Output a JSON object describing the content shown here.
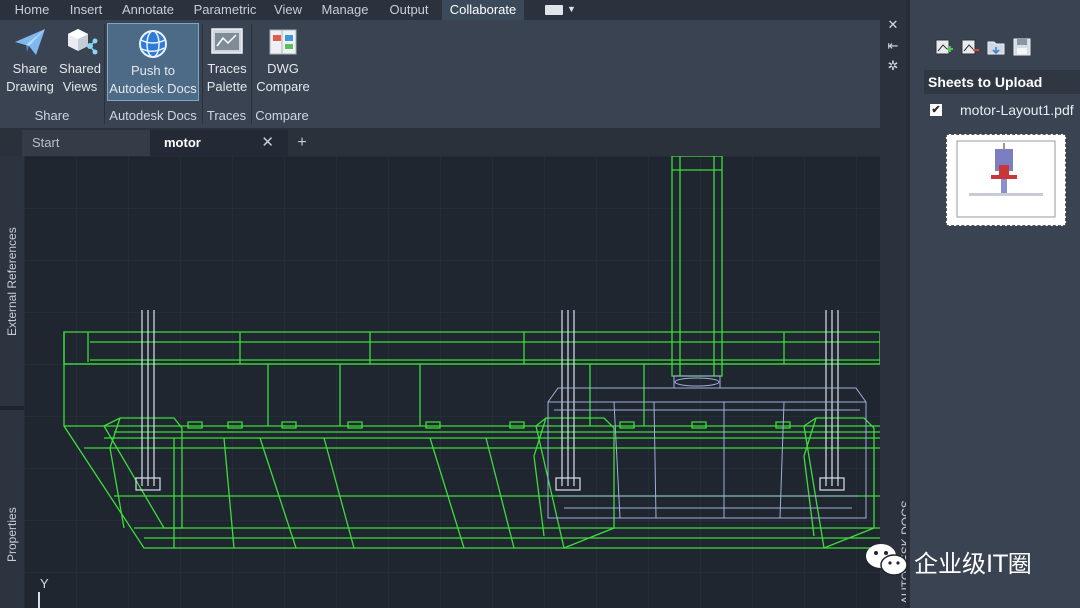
{
  "menu": {
    "tabs": [
      "Home",
      "Insert",
      "Annotate",
      "Parametric",
      "View",
      "Manage",
      "Output",
      "Collaborate"
    ],
    "active_tab": "Collaborate"
  },
  "ribbon": {
    "buttons": [
      {
        "label": "Share\nDrawing",
        "icon": "paper-plane-icon"
      },
      {
        "label": "Shared\nViews",
        "icon": "cube-share-icon"
      },
      {
        "label": "Push to\nAutodesk Docs",
        "icon": "globe-icon"
      },
      {
        "label": "Traces\nPalette",
        "icon": "traces-palette-icon"
      },
      {
        "label": "DWG\nCompare",
        "icon": "dwg-compare-icon"
      }
    ],
    "panels": [
      "Share",
      "Autodesk Docs",
      "Traces",
      "Compare"
    ]
  },
  "doc_tabs": {
    "start": "Start",
    "active": "motor",
    "close_glyph": "✕",
    "add_glyph": "+"
  },
  "left_palettes": {
    "external_references": "External References",
    "properties": "Properties"
  },
  "ucs": {
    "y_label": "Y"
  },
  "side_toolbar": {
    "close_glyph": "✕",
    "docs_label": "AUTODESK DOCS"
  },
  "upload_panel": {
    "header": "Sheets to Upload",
    "sheet_name": "motor-Layout1.pdf",
    "checkbox_glyph": "✔"
  },
  "watermark": {
    "text": "企业级IT圈"
  },
  "colors": {
    "wireframe": "#3ddc3a",
    "active_tab": "#3b4a5a",
    "highlight": "#4d6a86",
    "ribbon_bg": "#3a4351"
  }
}
